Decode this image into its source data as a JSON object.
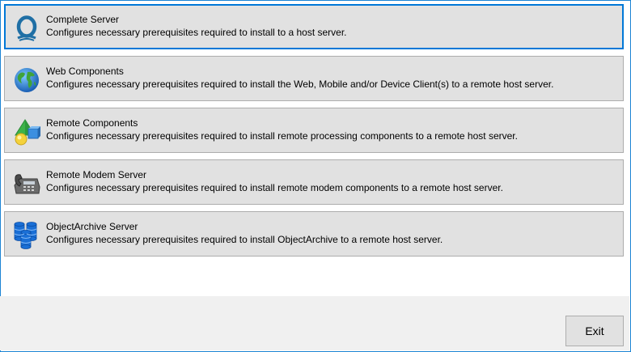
{
  "options": [
    {
      "title": "Complete Server",
      "description": "Configures necessary prerequisites required to install to a host server.",
      "icon": "q-logo-icon",
      "selected": true
    },
    {
      "title": "Web Components",
      "description": "Configures necessary prerequisites required to install the Web, Mobile and/or Device Client(s) to a remote host server.",
      "icon": "globe-icon"
    },
    {
      "title": "Remote Components",
      "description": "Configures necessary prerequisites required to install remote processing components to a remote host server.",
      "icon": "shapes-icon"
    },
    {
      "title": "Remote Modem Server",
      "description": "Configures necessary prerequisites required to install remote modem components to a remote host server.",
      "icon": "telephone-icon"
    },
    {
      "title": "ObjectArchive Server",
      "description": "Configures necessary prerequisites required to install ObjectArchive to a remote host server.",
      "icon": "database-icon"
    }
  ],
  "exit_label": "Exit",
  "colors": {
    "accent": "#0078d7",
    "button_bg": "#e1e1e1",
    "footer_bg": "#f0f0f0"
  }
}
